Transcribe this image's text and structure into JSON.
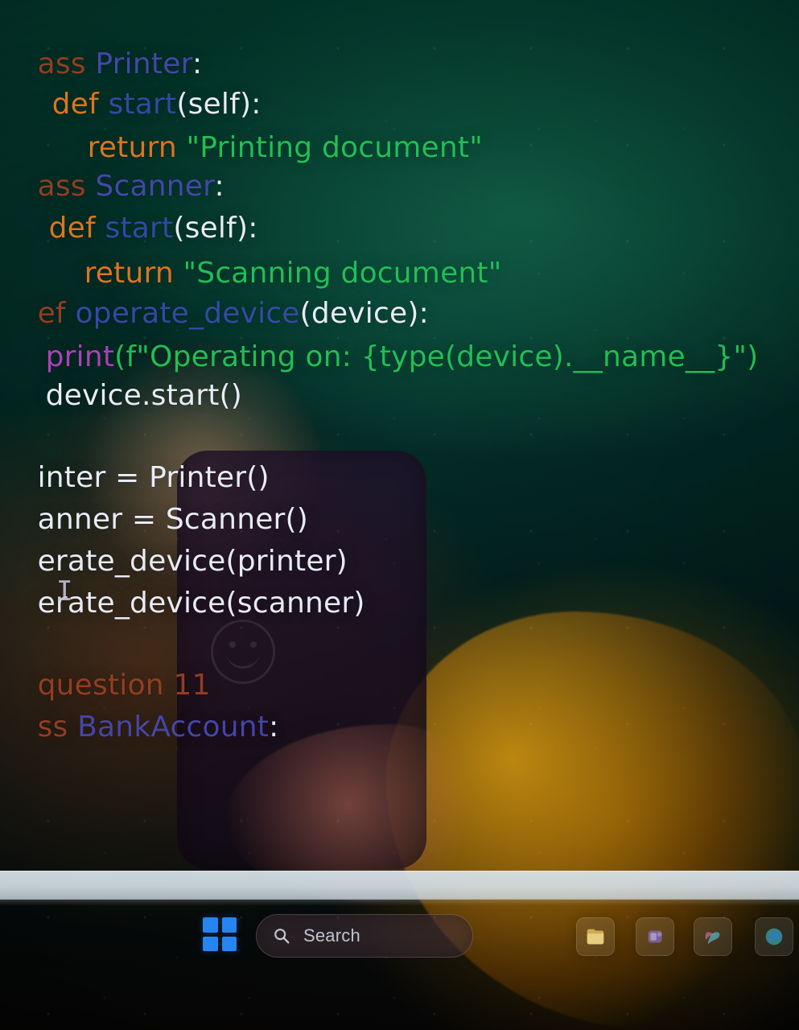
{
  "colors": {
    "keyword": "#d9782a",
    "function": "#5a6fe0",
    "class": "#6f6be0",
    "string": "#23c85a",
    "builtin": "#b946c8",
    "text": "#eef2ff",
    "taskbar_strip": "#d6e2ea",
    "windows_blue": "#288cff"
  },
  "code": {
    "l1_kw": "ass",
    "l1_name": " Printer",
    "l1_tail": ":",
    "l2_kw": "def",
    "l2_name": " start",
    "l2_tail": "(self):",
    "l3_kw": "return",
    "l3_str": " \"Printing document\"",
    "l4_kw": "ass",
    "l4_name": " Scanner",
    "l4_tail": ":",
    "l5_kw": "def",
    "l5_name": " start",
    "l5_tail": "(self):",
    "l6_kw": "return",
    "l6_str": " \"Scanning document\"",
    "l7_kw": "ef",
    "l7_name": " operate_device",
    "l7_tail": "(device):",
    "l8_fn": "print",
    "l8_tail": "(f\"Operating on: {type(device).__name__}\")",
    "l9": "device.start()",
    "l10": "inter = Printer()",
    "l11": "anner = Scanner()",
    "l12": "erate_device(printer)",
    "l13": "erate_device(scanner)",
    "l14": "question 11",
    "l15_kw": "ss",
    "l15_name": " BankAccount",
    "l15_tail": ":"
  },
  "icons": {
    "text_cursor": "I-beam-cursor",
    "start": "windows-logo-icon",
    "search": "search-icon",
    "files": "file-explorer-icon",
    "teams": "teams-icon",
    "copilot": "copilot-icon",
    "edge": "edge-icon"
  },
  "taskbar": {
    "search_label": "Search"
  }
}
